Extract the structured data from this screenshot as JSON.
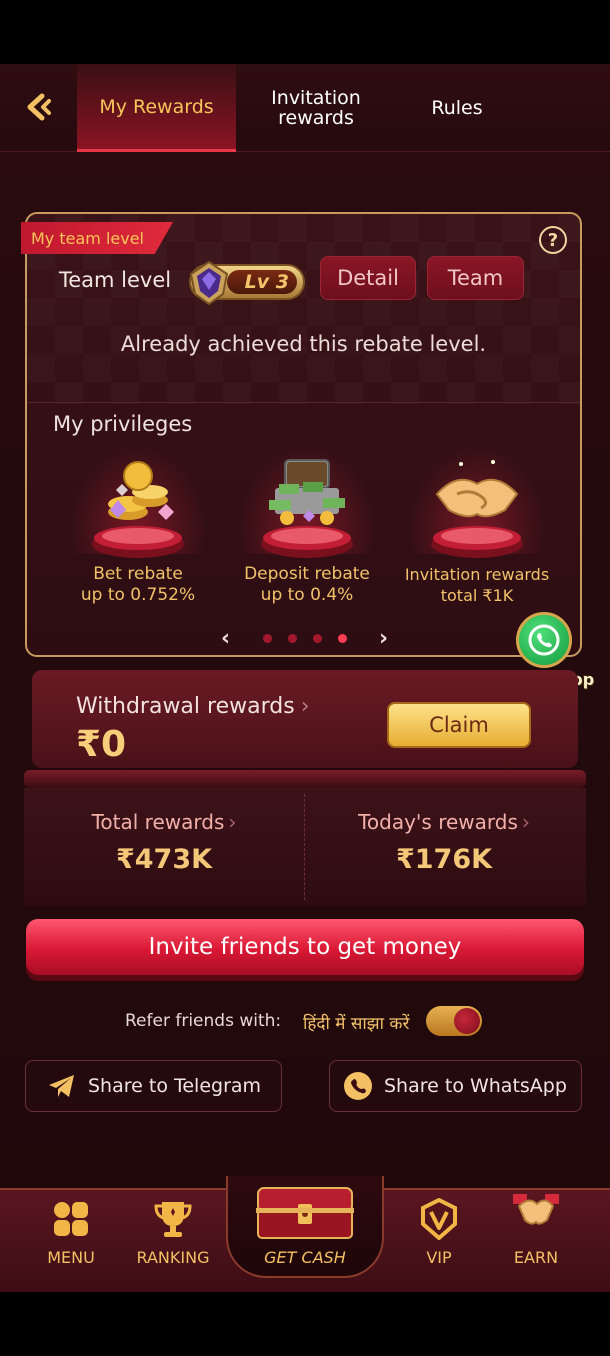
{
  "header": {
    "tabs": [
      {
        "label": "My Rewards",
        "active": true
      },
      {
        "label": "Invitation rewards",
        "active": false
      },
      {
        "label": "Rules",
        "active": false
      }
    ]
  },
  "team_card": {
    "tag": "My team level",
    "team_level_label": "Team level",
    "level_badge": "Lv 3",
    "detail_button": "Detail",
    "team_button": "Team",
    "status_text": "Already achieved this rebate level.",
    "privileges_title": "My privileges",
    "privileges": [
      {
        "line1": "Bet rebate",
        "line2": "up to 0.752%",
        "icon": "coins-gems-icon"
      },
      {
        "line1": "Deposit rebate",
        "line2": "up to 0.4%",
        "icon": "cash-chest-icon"
      },
      {
        "line1": "Invitation rewards",
        "line2": "total ₹1K",
        "icon": "handshake-icon"
      }
    ],
    "pager": {
      "pages": 4,
      "active_index": 3
    }
  },
  "whatsapp_float": {
    "label": "WhatsApp"
  },
  "withdrawal": {
    "title": "Withdrawal rewards",
    "amount": "₹0",
    "claim_button": "Claim"
  },
  "totals": {
    "total_label": "Total rewards",
    "total_value": "₹473K",
    "today_label": "Today's rewards",
    "today_value": "₹176K"
  },
  "invite_button": "Invite friends to get money",
  "refer": {
    "label": "Refer friends with:",
    "language": "हिंदी में साझा करें",
    "toggle_on": true
  },
  "share": {
    "telegram": "Share to Telegram",
    "whatsapp": "Share to WhatsApp"
  },
  "bottom_nav": {
    "items": [
      {
        "label": "MENU",
        "icon": "menu-grid-icon"
      },
      {
        "label": "RANKING",
        "icon": "trophy-icon"
      },
      {
        "label": "GET CASH",
        "icon": "treasure-chest-icon"
      },
      {
        "label": "VIP",
        "icon": "vip-shield-icon"
      },
      {
        "label": "EARN",
        "icon": "handshake-icon"
      }
    ]
  },
  "colors": {
    "accent_gold": "#f7c55a",
    "accent_red": "#e02a3c",
    "background": "#260a0e"
  }
}
